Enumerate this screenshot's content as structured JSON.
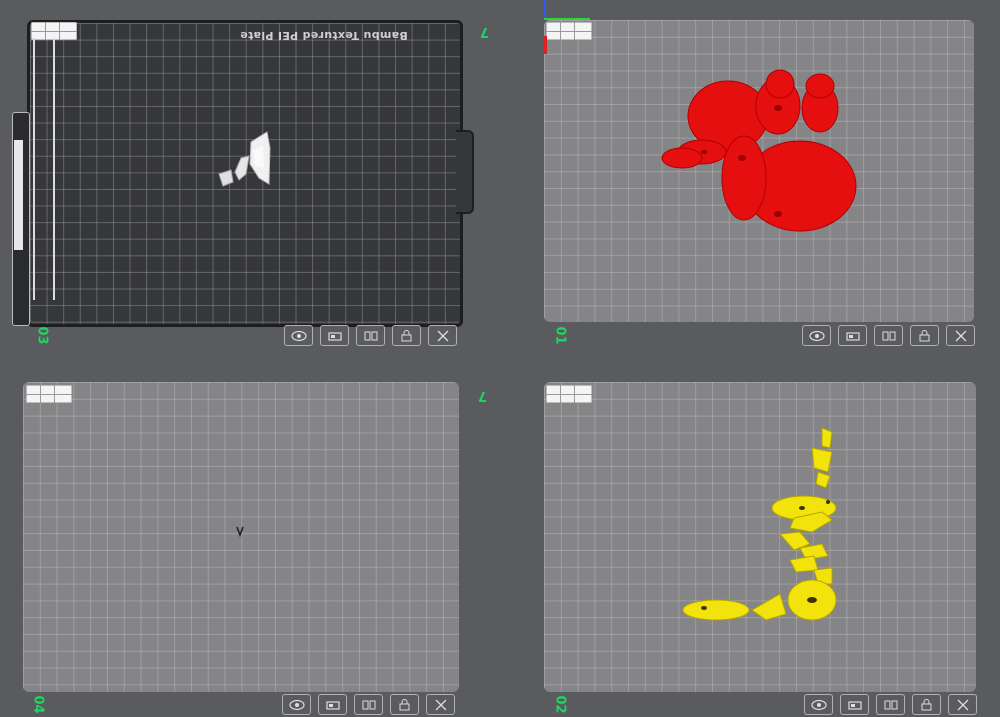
{
  "plates": [
    {
      "number": "03",
      "name": "Bambu Textured PEI Plate",
      "corner_label": "7"
    },
    {
      "number": "01",
      "name": "",
      "corner_label": ""
    },
    {
      "number": "04",
      "name": "",
      "corner_label": "7"
    },
    {
      "number": "02",
      "name": "",
      "corner_label": ""
    }
  ],
  "colors": {
    "red_part": "#e60f0f",
    "yellow_part": "#f2e30c",
    "white_part": "#f0f0f0",
    "plate_number": "#1ed760"
  },
  "toolbar_icons": [
    "eye-icon",
    "orient-icon",
    "arrange-icon",
    "lock-icon",
    "close-icon"
  ]
}
